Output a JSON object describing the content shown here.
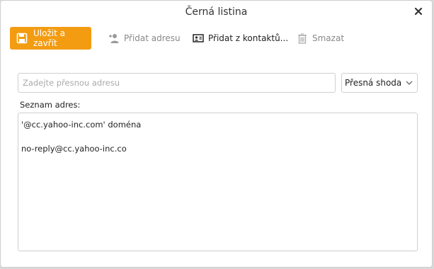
{
  "dialog": {
    "title": "Černá listina"
  },
  "toolbar": {
    "save_close_label": "Uložit a zavřít",
    "add_address_label": "Přidat adresu",
    "add_from_contacts_label": "Přidat z kontaktů...",
    "delete_label": "Smazat"
  },
  "search": {
    "placeholder": "Zadejte přesnou adresu",
    "value": ""
  },
  "match_select": {
    "selected": "Přesná shoda"
  },
  "address_list": {
    "label": "Seznam adres:",
    "items": [
      "'@cc.yahoo-inc.com' doména",
      "no-reply@cc.yahoo-inc.co"
    ]
  },
  "colors": {
    "accent": "#f39c12",
    "border": "#cfcfcf",
    "disabled_text": "#888888"
  },
  "icons": {
    "close": "close-icon",
    "save": "floppy-disk-icon",
    "add_address": "add-user-icon",
    "contacts": "contact-card-icon",
    "delete": "trash-icon",
    "dropdown": "chevron-down-icon"
  }
}
